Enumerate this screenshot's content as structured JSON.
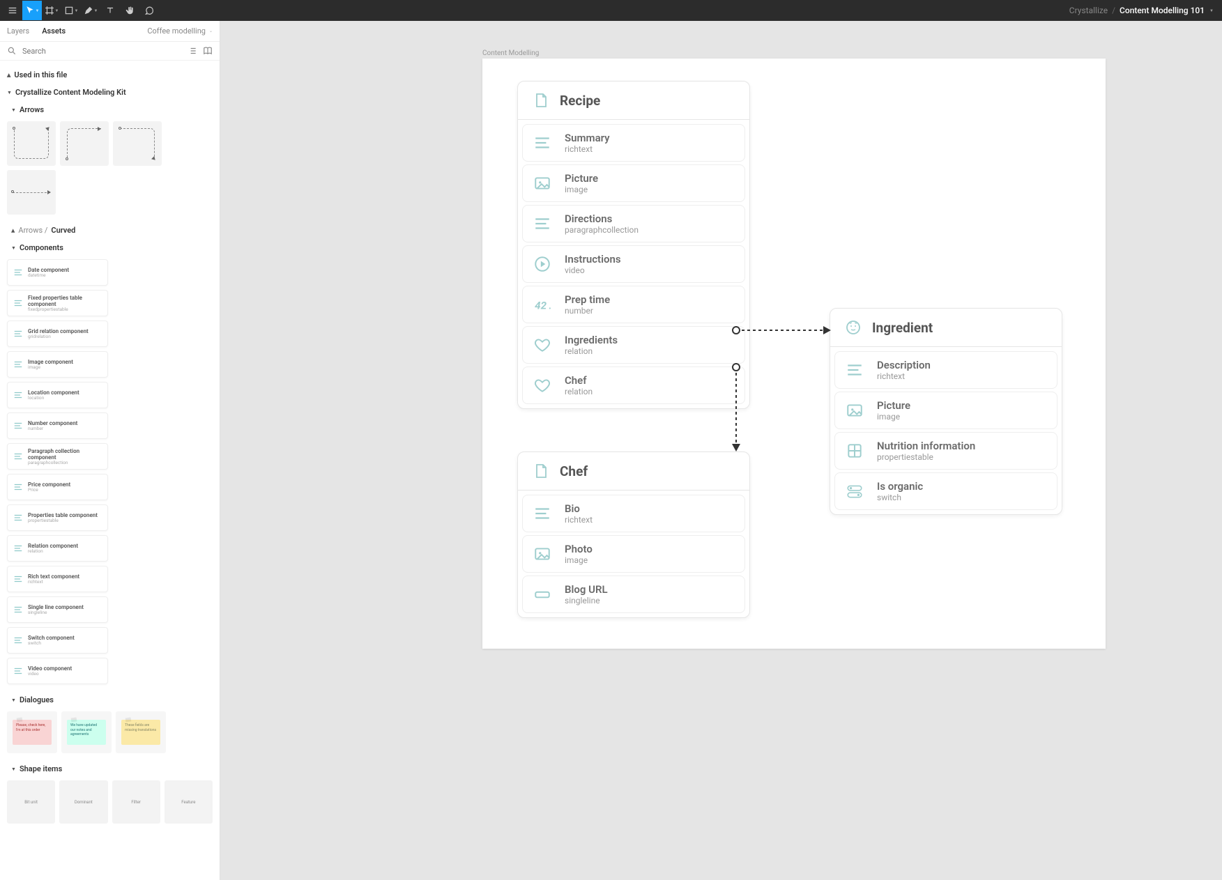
{
  "breadcrumbs": {
    "org": "Crystallize",
    "file": "Content Modelling 101"
  },
  "sidebar": {
    "tabs": {
      "layers": "Layers",
      "assets": "Assets"
    },
    "page": "Coffee modelling",
    "search_placeholder": "Search",
    "sections": {
      "used": "Used in this file",
      "kit": "Crystallize Content Modeling Kit",
      "arrows": "Arrows",
      "arrows_curved_prefix": "Arrows /",
      "arrows_curved": "Curved",
      "components": "Components",
      "dialogues": "Dialogues",
      "shapes": "Shape items"
    },
    "components": [
      {
        "t": "Date component",
        "s": "datetime"
      },
      {
        "t": "Fixed properties table component",
        "s": "fixedpropertiestable"
      },
      {
        "t": "Grid relation component",
        "s": "gridrelation"
      },
      {
        "t": "Image component",
        "s": "image"
      },
      {
        "t": "Location component",
        "s": "location"
      },
      {
        "t": "Number component",
        "s": "number"
      },
      {
        "t": "Paragraph collection component",
        "s": "paragraphcollection"
      },
      {
        "t": "Price component",
        "s": "Price"
      },
      {
        "t": "Properties table component",
        "s": "propertiestable"
      },
      {
        "t": "Relation component",
        "s": "relation"
      },
      {
        "t": "Rich text component",
        "s": "richtext"
      },
      {
        "t": "Single line component",
        "s": "singleline"
      },
      {
        "t": "Switch component",
        "s": "switch"
      },
      {
        "t": "Video component",
        "s": "video"
      }
    ],
    "dialogues": [
      {
        "cls": "pink",
        "text": "Please, check here, I'm at this order"
      },
      {
        "cls": "teal",
        "text": "We have updated our notes and agreements"
      },
      {
        "cls": "yellow",
        "text": "These fields are missing translations"
      }
    ],
    "shape_items": [
      "Bit unit",
      "Dominant",
      "Filter",
      "Feature"
    ]
  },
  "canvas": {
    "frame_label": "Content Modelling",
    "cards": {
      "recipe": {
        "title": "Recipe",
        "fields": [
          {
            "name": "Summary",
            "type": "richtext",
            "icon": "richtext"
          },
          {
            "name": "Picture",
            "type": "image",
            "icon": "image"
          },
          {
            "name": "Directions",
            "type": "paragraphcollection",
            "icon": "richtext"
          },
          {
            "name": "Instructions",
            "type": "video",
            "icon": "video"
          },
          {
            "name": "Prep time",
            "type": "number",
            "icon": "number"
          },
          {
            "name": "Ingredients",
            "type": "relation",
            "icon": "relation"
          },
          {
            "name": "Chef",
            "type": "relation",
            "icon": "relation"
          }
        ]
      },
      "ingredient": {
        "title": "Ingredient",
        "fields": [
          {
            "name": "Description",
            "type": "richtext",
            "icon": "richtext"
          },
          {
            "name": "Picture",
            "type": "image",
            "icon": "image"
          },
          {
            "name": "Nutrition information",
            "type": "propertiestable",
            "icon": "properties"
          },
          {
            "name": "Is organic",
            "type": "switch",
            "icon": "switch"
          }
        ]
      },
      "chef": {
        "title": "Chef",
        "fields": [
          {
            "name": "Bio",
            "type": "richtext",
            "icon": "richtext"
          },
          {
            "name": "Photo",
            "type": "image",
            "icon": "image"
          },
          {
            "name": "Blog URL",
            "type": "singleline",
            "icon": "singleline"
          }
        ]
      }
    }
  }
}
